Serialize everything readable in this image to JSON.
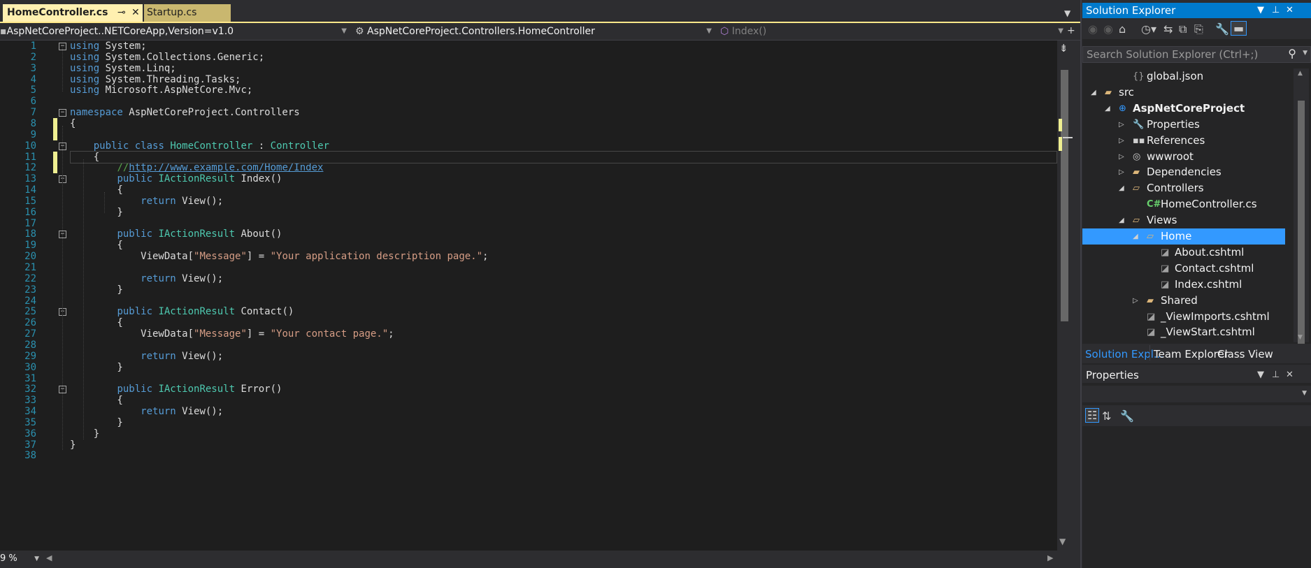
{
  "editor": {
    "tabs": [
      {
        "label": "HomeController.cs",
        "active": true
      },
      {
        "label": "Startup.cs",
        "active": false
      }
    ],
    "nav": {
      "project": "AspNetCoreProject..NETCoreApp,Version=v1.0",
      "type": "AspNetCoreProject.Controllers.HomeController",
      "member": "Index()"
    },
    "zoom": "9 %",
    "lines": [
      {
        "n": "1",
        "tokens": [
          {
            "t": "using",
            "c": "kw"
          },
          {
            "t": " System;"
          }
        ]
      },
      {
        "n": "2",
        "tokens": [
          {
            "t": "using",
            "c": "kw"
          },
          {
            "t": " System.Collections.Generic;"
          }
        ]
      },
      {
        "n": "3",
        "tokens": [
          {
            "t": "using",
            "c": "kw"
          },
          {
            "t": " System.Linq;"
          }
        ]
      },
      {
        "n": "4",
        "tokens": [
          {
            "t": "using",
            "c": "kw"
          },
          {
            "t": " System.Threading.Tasks;"
          }
        ]
      },
      {
        "n": "5",
        "tokens": [
          {
            "t": "using",
            "c": "kw"
          },
          {
            "t": " Microsoft.AspNetCore.Mvc;"
          }
        ]
      },
      {
        "n": "6",
        "tokens": []
      },
      {
        "n": "7",
        "tokens": [
          {
            "t": "namespace",
            "c": "kw"
          },
          {
            "t": " AspNetCoreProject.Controllers"
          }
        ]
      },
      {
        "n": "8",
        "tokens": [
          {
            "t": "{"
          }
        ]
      },
      {
        "n": "9",
        "tokens": []
      },
      {
        "n": "10",
        "tokens": [
          {
            "t": "    "
          },
          {
            "t": "public",
            "c": "kw"
          },
          {
            "t": " "
          },
          {
            "t": "class",
            "c": "kw"
          },
          {
            "t": " "
          },
          {
            "t": "HomeController",
            "c": "ty"
          },
          {
            "t": " : "
          },
          {
            "t": "Controller",
            "c": "ty"
          }
        ]
      },
      {
        "n": "11",
        "tokens": [
          {
            "t": "    {"
          }
        ]
      },
      {
        "n": "12",
        "tokens": [
          {
            "t": "        "
          },
          {
            "t": "//",
            "c": "cm"
          },
          {
            "t": "http://www.example.com/Home/Index",
            "c": "lk"
          }
        ]
      },
      {
        "n": "13",
        "tokens": [
          {
            "t": "        "
          },
          {
            "t": "public",
            "c": "kw"
          },
          {
            "t": " "
          },
          {
            "t": "IActionResult",
            "c": "ty"
          },
          {
            "t": " Index()"
          }
        ]
      },
      {
        "n": "14",
        "tokens": [
          {
            "t": "        {"
          }
        ]
      },
      {
        "n": "15",
        "tokens": [
          {
            "t": "            "
          },
          {
            "t": "return",
            "c": "kw"
          },
          {
            "t": " View();"
          }
        ]
      },
      {
        "n": "16",
        "tokens": [
          {
            "t": "        }"
          }
        ]
      },
      {
        "n": "17",
        "tokens": []
      },
      {
        "n": "18",
        "tokens": [
          {
            "t": "        "
          },
          {
            "t": "public",
            "c": "kw"
          },
          {
            "t": " "
          },
          {
            "t": "IActionResult",
            "c": "ty"
          },
          {
            "t": " About()"
          }
        ]
      },
      {
        "n": "19",
        "tokens": [
          {
            "t": "        {"
          }
        ]
      },
      {
        "n": "20",
        "tokens": [
          {
            "t": "            ViewData["
          },
          {
            "t": "\"Message\"",
            "c": "st"
          },
          {
            "t": "] = "
          },
          {
            "t": "\"Your application description page.\"",
            "c": "st"
          },
          {
            "t": ";"
          }
        ]
      },
      {
        "n": "21",
        "tokens": []
      },
      {
        "n": "22",
        "tokens": [
          {
            "t": "            "
          },
          {
            "t": "return",
            "c": "kw"
          },
          {
            "t": " View();"
          }
        ]
      },
      {
        "n": "23",
        "tokens": [
          {
            "t": "        }"
          }
        ]
      },
      {
        "n": "24",
        "tokens": []
      },
      {
        "n": "25",
        "tokens": [
          {
            "t": "        "
          },
          {
            "t": "public",
            "c": "kw"
          },
          {
            "t": " "
          },
          {
            "t": "IActionResult",
            "c": "ty"
          },
          {
            "t": " Contact()"
          }
        ]
      },
      {
        "n": "26",
        "tokens": [
          {
            "t": "        {"
          }
        ]
      },
      {
        "n": "27",
        "tokens": [
          {
            "t": "            ViewData["
          },
          {
            "t": "\"Message\"",
            "c": "st"
          },
          {
            "t": "] = "
          },
          {
            "t": "\"Your contact page.\"",
            "c": "st"
          },
          {
            "t": ";"
          }
        ]
      },
      {
        "n": "28",
        "tokens": []
      },
      {
        "n": "29",
        "tokens": [
          {
            "t": "            "
          },
          {
            "t": "return",
            "c": "kw"
          },
          {
            "t": " View();"
          }
        ]
      },
      {
        "n": "30",
        "tokens": [
          {
            "t": "        }"
          }
        ]
      },
      {
        "n": "31",
        "tokens": []
      },
      {
        "n": "32",
        "tokens": [
          {
            "t": "        "
          },
          {
            "t": "public",
            "c": "kw"
          },
          {
            "t": " "
          },
          {
            "t": "IActionResult",
            "c": "ty"
          },
          {
            "t": " Error()"
          }
        ]
      },
      {
        "n": "33",
        "tokens": [
          {
            "t": "        {"
          }
        ]
      },
      {
        "n": "34",
        "tokens": [
          {
            "t": "            "
          },
          {
            "t": "return",
            "c": "kw"
          },
          {
            "t": " View();"
          }
        ]
      },
      {
        "n": "35",
        "tokens": [
          {
            "t": "        }"
          }
        ]
      },
      {
        "n": "36",
        "tokens": [
          {
            "t": "    }"
          }
        ]
      },
      {
        "n": "37",
        "tokens": [
          {
            "t": "}"
          }
        ]
      },
      {
        "n": "38",
        "tokens": []
      }
    ]
  },
  "solution_explorer": {
    "title": "Solution Explorer",
    "search_placeholder": "Search Solution Explorer (Ctrl+;)",
    "tree": [
      {
        "label": "global.json",
        "icon": "json-file-icon",
        "level": 2,
        "expander": "none"
      },
      {
        "label": "src",
        "icon": "folder-icon",
        "level": 0,
        "expander": "expanded"
      },
      {
        "label": "AspNetCoreProject",
        "icon": "project-icon",
        "level": 1,
        "expander": "expanded",
        "bold": true
      },
      {
        "label": "Properties",
        "icon": "wrench-icon",
        "level": 2,
        "expander": "collapsed"
      },
      {
        "label": "References",
        "icon": "references-icon",
        "level": 2,
        "expander": "collapsed"
      },
      {
        "label": "wwwroot",
        "icon": "globe-icon",
        "level": 2,
        "expander": "collapsed"
      },
      {
        "label": "Dependencies",
        "icon": "folder-icon",
        "level": 2,
        "expander": "collapsed"
      },
      {
        "label": "Controllers",
        "icon": "folder-open-icon",
        "level": 2,
        "expander": "expanded"
      },
      {
        "label": "HomeController.cs",
        "icon": "csharp-file-icon",
        "level": 3,
        "expander": "none"
      },
      {
        "label": "Views",
        "icon": "folder-open-icon",
        "level": 2,
        "expander": "expanded"
      },
      {
        "label": "Home",
        "icon": "folder-open-icon",
        "level": 3,
        "expander": "expanded",
        "selected": true
      },
      {
        "label": "About.cshtml",
        "icon": "cshtml-file-icon",
        "level": 4,
        "expander": "none"
      },
      {
        "label": "Contact.cshtml",
        "icon": "cshtml-file-icon",
        "level": 4,
        "expander": "none"
      },
      {
        "label": "Index.cshtml",
        "icon": "cshtml-file-icon",
        "level": 4,
        "expander": "none"
      },
      {
        "label": "Shared",
        "icon": "folder-icon",
        "level": 3,
        "expander": "collapsed"
      },
      {
        "label": "_ViewImports.cshtml",
        "icon": "cshtml-file-icon",
        "level": 3,
        "expander": "none"
      },
      {
        "label": "_ViewStart.cshtml",
        "icon": "cshtml-file-icon",
        "level": 3,
        "expander": "none"
      }
    ],
    "bottom_tabs": [
      {
        "label": "Solution Expl...",
        "active": true
      },
      {
        "label": "Team Explorer",
        "active": false
      },
      {
        "label": "Class View",
        "active": false
      }
    ]
  },
  "properties": {
    "title": "Properties"
  },
  "colors": {
    "accent": "#007acc",
    "selection": "#3399ff",
    "active_tab": "#fff0b0",
    "keyword": "#569cd6",
    "type": "#4ec9b0",
    "string": "#d69d85",
    "comment": "#57a64a",
    "change_marker": "#efef91"
  }
}
